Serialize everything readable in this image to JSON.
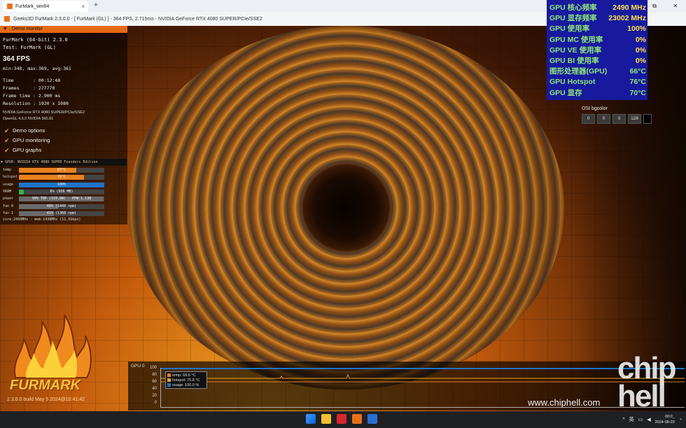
{
  "browser": {
    "tab_title": "FurMark_win64",
    "new_tab": "+",
    "tab_close": "×",
    "win_min": "—",
    "win_max": "▢",
    "win_close": "✕",
    "restore": "⧉"
  },
  "window": {
    "title": "Geeks3D FurMark 2.3.0.0 - [ FurMark (GL) ] - 364 FPS, 2.715ms - NVIDIA GeForce RTX 4080 SUPER/PCIe/SSE2"
  },
  "panel": {
    "header": "Demo monitor",
    "app": "FurMark (64-bit) 2.3.0",
    "test": "Test: FurMark (GL)",
    "fps": "364 FPS",
    "fps_minmax": "min:348, max:369, avg:361",
    "time_row": "Time       : 00:12:48",
    "frames_row": "Frames     : 277770",
    "frametime_row": "Frame time : 2.900 ms",
    "resolution_row": "Resolution : 1920 x 1080",
    "gpu_info": "NVIDIA GeForce RTX 4080 SUPER/PCIe/SSE2",
    "gl_info": "OpenGL 4.6.0 NVIDIA 560.81",
    "checkboxes": [
      "Demo options",
      "GPU monitoring",
      "GPU graphs"
    ],
    "check_glyph": "✔",
    "gpu_header": "▼  GPU0: NVIDIA RTX 4080 SUPER Founders Edition",
    "bars": [
      {
        "label": "temp",
        "value": "67°C",
        "fill": 0.67,
        "color": "#e8821e"
      },
      {
        "label": "hotspot",
        "value": "76°C",
        "fill": 0.76,
        "color": "#e8821e"
      },
      {
        "label": "usage",
        "value": "100%",
        "fill": 1.0,
        "color": "#1e74c8"
      },
      {
        "label": "VRAM",
        "value": "6% (956 MB)",
        "fill": 0.06,
        "color": "#2fae52"
      },
      {
        "label": "power",
        "value": "99% TDP (319.8W) - PPW:1.138",
        "fill": 0.99,
        "color": "#6a6a6a"
      },
      {
        "label": "fan 0",
        "value": "46% (1448 rpm)",
        "fill": 0.46,
        "color": "#6a6a6a"
      },
      {
        "label": "fan 1",
        "value": "41% (1368 rpm)",
        "fill": 0.41,
        "color": "#6a6a6a"
      }
    ],
    "core_line": "core:2460MHz - mem:1438MHz (11.5Gbps)"
  },
  "logo": {
    "text": "FURMARK",
    "build": "2.3.0.0 build May  5 2024@10:41:42"
  },
  "osd": {
    "rows": [
      {
        "key": "GPU 核心频率",
        "value": "2490 MHz"
      },
      {
        "key": "GPU 显存频率",
        "value": "23002 MHz"
      },
      {
        "key": "GPU 使用率",
        "value": "100%"
      },
      {
        "key": "GPU MC 使用率",
        "value": "0%"
      },
      {
        "key": "GPU VE 使用率",
        "value": "0%"
      },
      {
        "key": "GPU BI 使用率",
        "value": "0%"
      },
      {
        "key": "图形处理器(GPU)",
        "value": "66°C"
      },
      {
        "key": "GPU Hotspot",
        "value": "76°C"
      },
      {
        "key": "GPU 显存",
        "value": "70°C"
      }
    ]
  },
  "osi": {
    "label": "OSI bgcolor",
    "values": [
      "0",
      "0",
      "0",
      "128"
    ]
  },
  "graph": {
    "title": "GPU 0",
    "yticks": [
      "100",
      "80",
      "60",
      "40",
      "20",
      "0"
    ],
    "legend": [
      {
        "text": "temp: 66.6 °C",
        "color": "#e8821e"
      },
      {
        "text": "hotspot: 75.8 °C",
        "color": "#f0a020"
      },
      {
        "text": "usage: 100.0 %",
        "color": "#1e74c8"
      }
    ]
  },
  "watermark": "www.chiphell.com",
  "chip_logo": "chip hell",
  "taskbar": {
    "lang": "英",
    "clock_time": "00:0_",
    "clock_date": "2024-08-20",
    "tray_up": "^"
  }
}
